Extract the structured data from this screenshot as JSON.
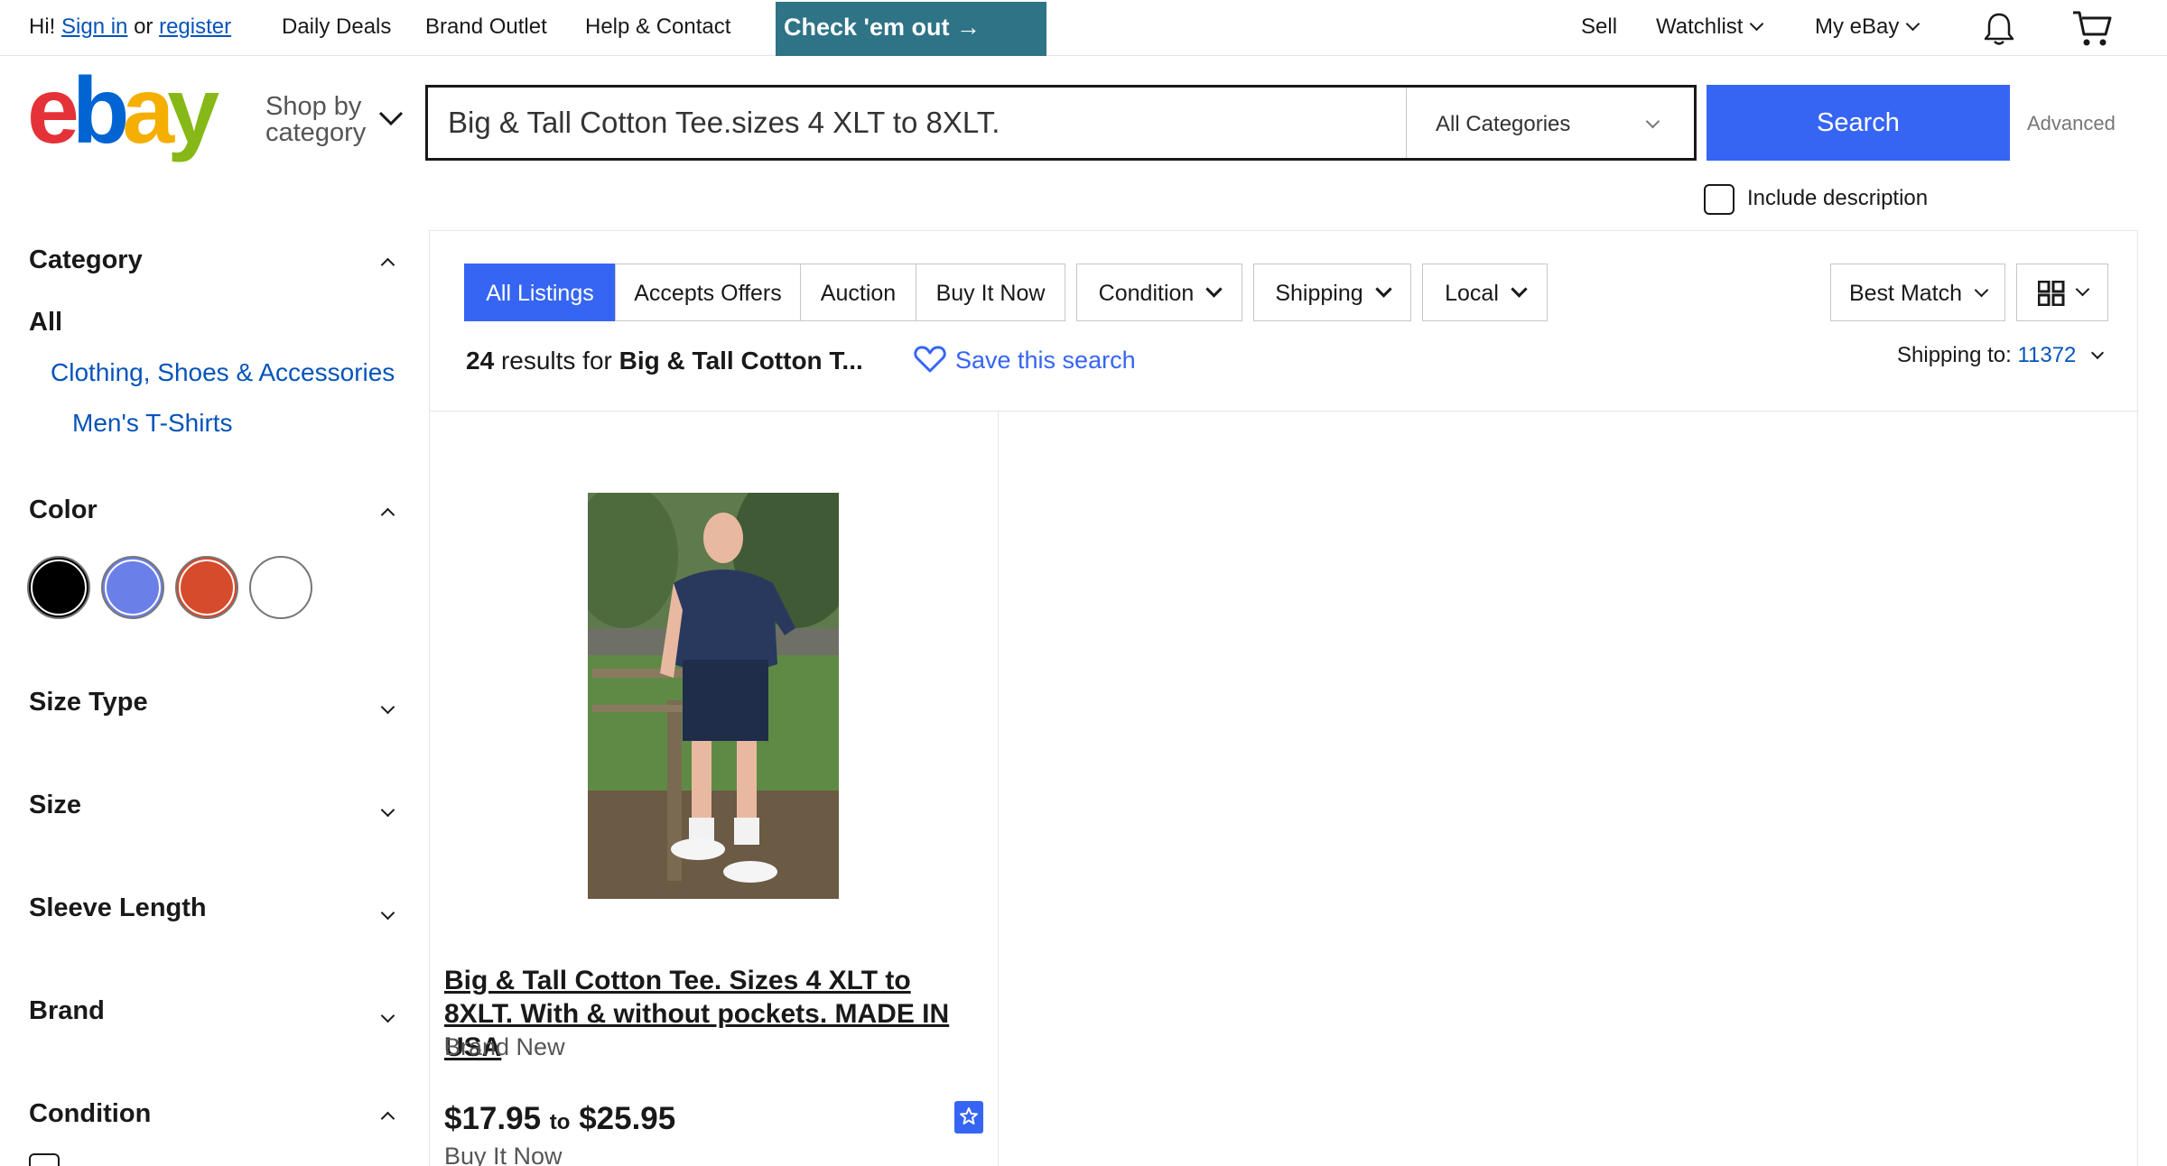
{
  "topbar": {
    "greeting": "Hi!",
    "sign_in": "Sign in",
    "or": "or",
    "register": "register",
    "daily_deals": "Daily Deals",
    "brand_outlet": "Brand Outlet",
    "help_contact": "Help & Contact",
    "promo": "Check 'em out →",
    "sell": "Sell",
    "watchlist": "Watchlist",
    "my_ebay": "My eBay",
    "notification_icon": "bell-icon",
    "cart_icon": "cart-icon"
  },
  "header": {
    "logo": "ebay",
    "logo_colors": [
      "#e53238",
      "#0064d2",
      "#f5af02",
      "#86b817"
    ],
    "shop_by_line1": "Shop by",
    "shop_by_line2": "category",
    "search_value": "Big & Tall Cotton Tee.sizes 4 XLT to 8XLT.",
    "category_select": "All Categories",
    "search_button": "Search",
    "advanced": "Advanced",
    "include_description": "Include description",
    "accent": "#3665f3"
  },
  "sidebar": {
    "category_heading": "Category",
    "category_all": "All",
    "category_l1": "Clothing, Shoes & Accessories",
    "category_l2": "Men's T-Shirts",
    "color_heading": "Color",
    "colors": [
      "#000000",
      "#6b7fe8",
      "#d64b2c",
      "#ffffff"
    ],
    "size_type": "Size Type",
    "size": "Size",
    "sleeve_length": "Sleeve Length",
    "brand": "Brand",
    "condition": "Condition"
  },
  "filters": {
    "tabs": [
      "All Listings",
      "Accepts Offers",
      "Auction",
      "Buy It Now"
    ],
    "dropdowns": [
      "Condition",
      "Shipping",
      "Local"
    ],
    "sort": "Best Match",
    "view_icon": "grid-view-icon"
  },
  "results": {
    "count": "24",
    "results_for": "results for",
    "query_truncated": "Big & Tall Cotton T...",
    "save_search": "Save this search",
    "shipping_to_label": "Shipping to:",
    "shipping_zip": "11372"
  },
  "listing": {
    "title": "Big & Tall Cotton Tee. Sizes 4 XLT to 8XLT. With & without pockets. MADE IN USA",
    "condition": "Brand New",
    "price_low": "$17.95",
    "price_to": "to",
    "price_high": "$25.95",
    "format": "Buy It Now"
  }
}
